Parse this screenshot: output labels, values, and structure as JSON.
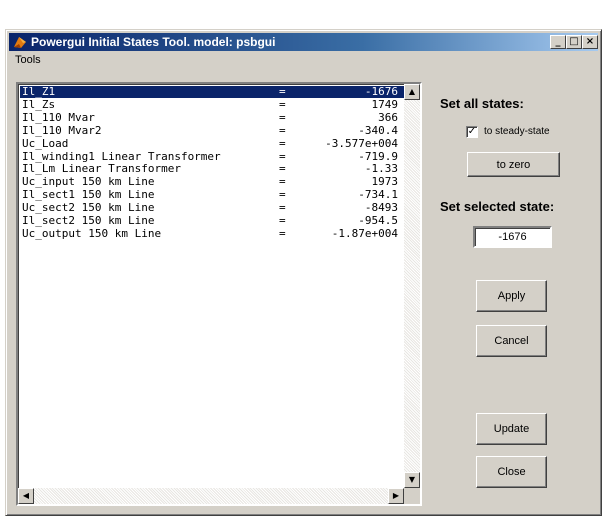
{
  "window": {
    "title": "Powergui Initial States Tool. model: psbgui",
    "controls": {
      "minimize": "_",
      "maximize": "□",
      "close": "×"
    }
  },
  "menubar": {
    "items": [
      "Tools"
    ]
  },
  "states_list": {
    "selected_index": 0,
    "rows": [
      {
        "name": "Il_Z1",
        "eq": "=",
        "value": "-1676"
      },
      {
        "name": "Il_Zs",
        "eq": "=",
        "value": "1749"
      },
      {
        "name": "Il_110 Mvar",
        "eq": "=",
        "value": "366"
      },
      {
        "name": "Il_110 Mvar2",
        "eq": "=",
        "value": "-340.4"
      },
      {
        "name": "Uc_Load",
        "eq": "=",
        "value": "-3.577e+004"
      },
      {
        "name": "Il_winding1 Linear Transformer",
        "eq": "=",
        "value": "-719.9"
      },
      {
        "name": "Il_Lm Linear Transformer",
        "eq": "=",
        "value": "-1.33"
      },
      {
        "name": "Uc_input 150 km Line",
        "eq": "=",
        "value": "1973"
      },
      {
        "name": "Il_sect1 150 km Line",
        "eq": "=",
        "value": "-734.1"
      },
      {
        "name": "Uc_sect2 150 km Line",
        "eq": "=",
        "value": "-8493"
      },
      {
        "name": "Il_sect2 150 km Line",
        "eq": "=",
        "value": "-954.5"
      },
      {
        "name": "Uc_output 150 km Line",
        "eq": "=",
        "value": "-1.87e+004"
      }
    ]
  },
  "scroll_icons": {
    "up": "▲",
    "down": "▼",
    "left": "◀",
    "right": "▶"
  },
  "set_all": {
    "heading": "Set all states:",
    "steady_checkbox": {
      "label": "to steady-state",
      "checked": true,
      "mark": "✓"
    },
    "zero_button": "to zero"
  },
  "set_selected": {
    "heading": "Set selected state:",
    "value": "-1676"
  },
  "buttons": {
    "apply": "Apply",
    "cancel": "Cancel",
    "update": "Update",
    "close": "Close"
  }
}
